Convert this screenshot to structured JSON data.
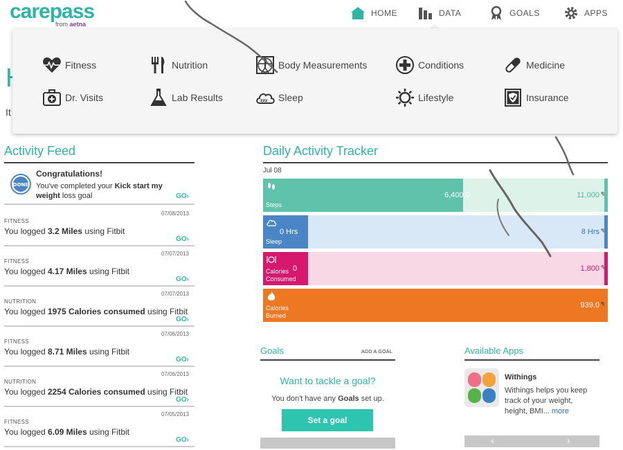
{
  "header": {
    "logo_main": "carepass",
    "logo_from": "from",
    "logo_brand": "aetna",
    "nav": [
      {
        "label": "HOME",
        "icon": "home-icon"
      },
      {
        "label": "DATA",
        "icon": "bar-chart-icon"
      },
      {
        "label": "GOALS",
        "icon": "ribbon-icon"
      },
      {
        "label": "APPS",
        "icon": "gear-icon"
      }
    ]
  },
  "background_partial": {
    "heading_fragment": "H",
    "text_fragment": "It"
  },
  "data_menu": {
    "items": [
      {
        "label": "Fitness",
        "icon": "heart-pulse-icon"
      },
      {
        "label": "Nutrition",
        "icon": "fork-knife-icon"
      },
      {
        "label": "Body Measurements",
        "icon": "vitruvian-body-icon"
      },
      {
        "label": "Conditions",
        "icon": "plus-circle-icon"
      },
      {
        "label": "Medicine",
        "icon": "pill-icon"
      },
      {
        "label": "Dr. Visits",
        "icon": "medical-kit-icon"
      },
      {
        "label": "Lab Results",
        "icon": "flask-icon"
      },
      {
        "label": "Sleep",
        "icon": "sleep-cloud-icon"
      },
      {
        "label": "Lifestyle",
        "icon": "sun-icon"
      },
      {
        "label": "Insurance",
        "icon": "insurance-card-icon"
      }
    ]
  },
  "activity_feed": {
    "title": "Activity Feed",
    "congrats": {
      "badge": "DONE",
      "title": "Congratulations!",
      "text_pre": "You've completed your ",
      "text_bold": "Kick start my weight",
      "text_post": " loss goal",
      "go": "GO›"
    },
    "entries": [
      {
        "date": "07/08/2013",
        "category": "FITNESS",
        "pre": "You logged ",
        "bold": "3.2 Miles",
        "post": " using Fitbit",
        "go": "GO›"
      },
      {
        "date": "07/07/2013",
        "category": "FITNESS",
        "pre": "You logged ",
        "bold": "4.17 Miles",
        "post": " using Fitbit",
        "go": "GO›"
      },
      {
        "date": "07/07/2013",
        "category": "NUTRITION",
        "pre": "You logged ",
        "bold": "1975 Calories consumed",
        "post": " using Fitbit",
        "go": "GO›"
      },
      {
        "date": "07/06/2013",
        "category": "FITNESS",
        "pre": "You logged ",
        "bold": "8.71 Miles",
        "post": " using Fitbit",
        "go": "GO›"
      },
      {
        "date": "07/06/2013",
        "category": "NUTRITION",
        "pre": "You logged ",
        "bold": "2254 Calories consumed",
        "post": " using Fitbit",
        "go": "GO›"
      },
      {
        "date": "07/05/2013",
        "category": "FITNESS",
        "pre": "You logged ",
        "bold": "6.09 Miles",
        "post": " using Fitbit",
        "go": "GO›"
      }
    ]
  },
  "tracker": {
    "title": "Daily Activity Tracker",
    "date": "Jul 08",
    "bars": [
      {
        "name": "Steps",
        "value": "6,400.0",
        "goal": "11,000",
        "progress": 0.58,
        "fill": "#5ec3aa",
        "track": "#ddf3ea",
        "goal_color": "#4fb79e",
        "cap": "#5ec3aa",
        "icon": "footprints-icon",
        "glyph": "❜❜"
      },
      {
        "name": "Sleep",
        "value": "0 Hrs",
        "goal": "8 Hrs",
        "progress": 0.13,
        "fill": "#4a86c6",
        "track": "#d8e8f7",
        "goal_color": "#3b78b8",
        "cap": "#4a86c6",
        "icon": "sleep-icon",
        "glyph": "☁"
      },
      {
        "name": "Calories\nConsumed",
        "value": "0",
        "goal": "1,800",
        "progress": 0.13,
        "fill": "#d6186f",
        "track": "#f9d8e6",
        "goal_color": "#d6186f",
        "cap": "#d6186f",
        "icon": "plate-icon",
        "glyph": "◎"
      },
      {
        "name": "Calories\nBurned",
        "value": "",
        "goal": "939.0",
        "progress": 1.0,
        "fill": "#ee7722",
        "track": "#ee7722",
        "goal_color": "#ffffff",
        "cap": "#ee7722",
        "icon": "flame-icon",
        "glyph": "♨"
      }
    ]
  },
  "goals": {
    "title": "Goals",
    "add_link": "ADD A GOAL",
    "cta": "Want to tackle a goal?",
    "none_pre": "You don't have any ",
    "none_bold": "Goals",
    "none_post": " set up.",
    "button": "Set a goal"
  },
  "apps": {
    "title": "Available Apps",
    "app_name": "Withings",
    "app_desc": "Withings helps you keep track of your weight, height, BMI...",
    "more": "more",
    "prev": "‹",
    "next": "›"
  },
  "colors": {
    "brand_teal": "#2db6a6",
    "brand_purple": "#7d3f98"
  }
}
